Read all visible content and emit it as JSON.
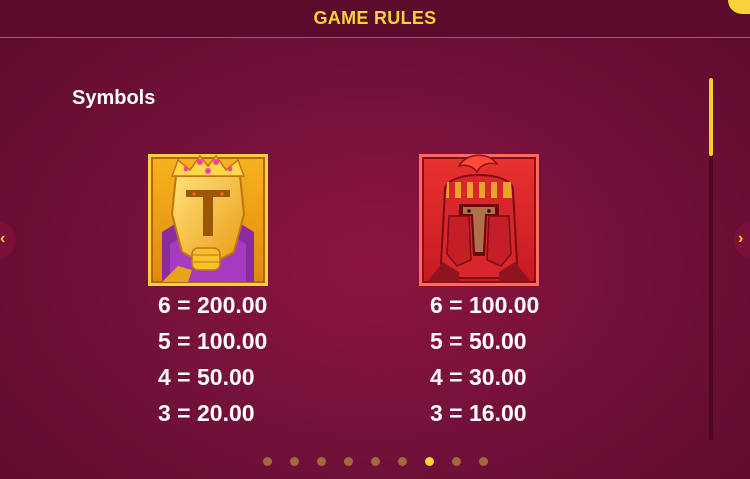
{
  "header": {
    "title": "GAME RULES"
  },
  "section": {
    "title": "Symbols"
  },
  "symbols": [
    {
      "icon": "golden-knight-helmet-icon",
      "pays": [
        "6 = 200.00",
        "5 = 100.00",
        "4 = 50.00",
        "3 = 20.00"
      ]
    },
    {
      "icon": "red-spartan-helmet-icon",
      "pays": [
        "6 = 100.00",
        "5 = 50.00",
        "4 = 30.00",
        "3 = 16.00"
      ]
    }
  ],
  "navigation": {
    "prev_icon": "chevron-left-icon",
    "next_icon": "chevron-right-icon",
    "prev_glyph": "‹",
    "next_glyph": "›"
  },
  "pager": {
    "total_pages": 9,
    "active_page": 7
  },
  "colors": {
    "background": "#74113a",
    "accent": "#f7d23a",
    "text": "#ffffff",
    "dot_inactive": "#a06a3a",
    "dot_active": "#ffd632"
  }
}
